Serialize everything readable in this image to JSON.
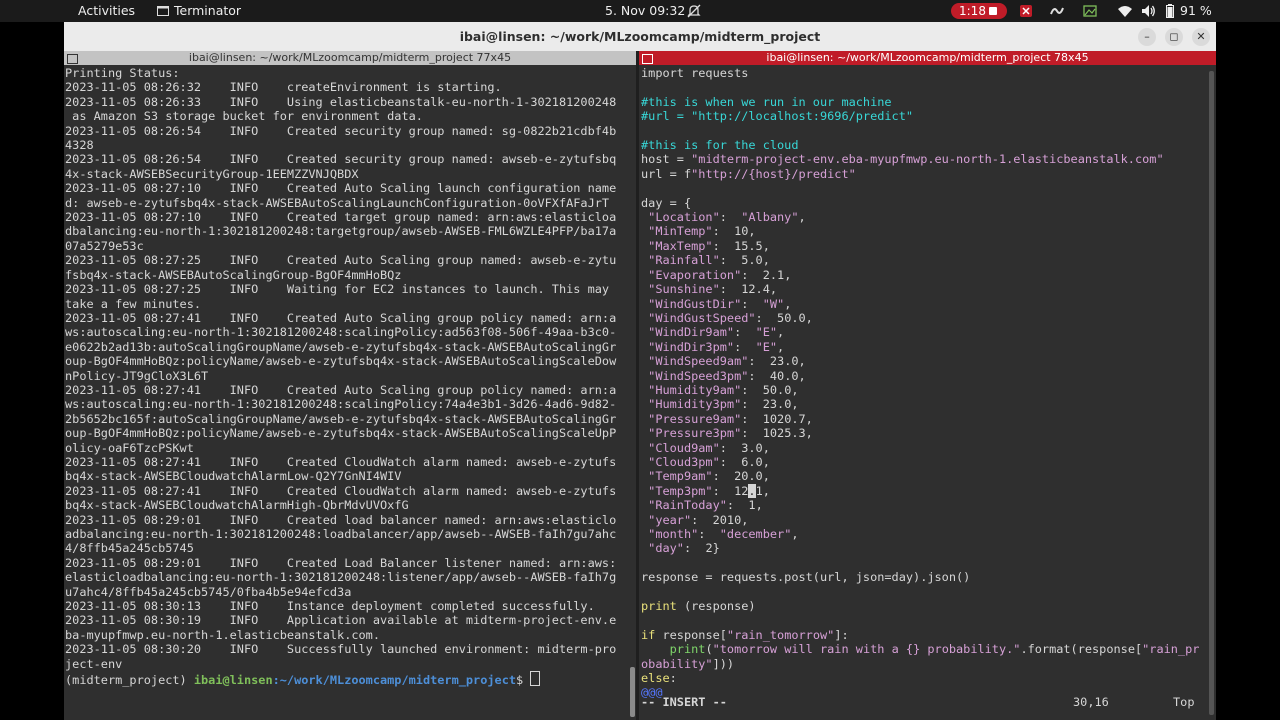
{
  "topbar": {
    "activities": "Activities",
    "app_name": "Terminator",
    "datetime": "5. Nov  09:32",
    "recording_time": "1:18",
    "battery": "91 %"
  },
  "window": {
    "title": "ibai@linsen: ~/work/MLzoomcamp/midterm_project",
    "minimize": "–",
    "maximize": "◻",
    "close": "✕"
  },
  "left_pane": {
    "title": "ibai@linsen: ~/work/MLzoomcamp/midterm_project 77x45",
    "lines": [
      "Printing Status:",
      "2023-11-05 08:26:32    INFO    createEnvironment is starting.",
      "2023-11-05 08:26:33    INFO    Using elasticbeanstalk-eu-north-1-302181200248",
      " as Amazon S3 storage bucket for environment data.",
      "2023-11-05 08:26:54    INFO    Created security group named: sg-0822b21cdbf4b",
      "4328",
      "2023-11-05 08:26:54    INFO    Created security group named: awseb-e-zytufsbq",
      "4x-stack-AWSEBSecurityGroup-1EEMZZVNJQBDX",
      "2023-11-05 08:27:10    INFO    Created Auto Scaling launch configuration name",
      "d: awseb-e-zytufsbq4x-stack-AWSEBAutoScalingLaunchConfiguration-0oVFXfAFaJrT",
      "2023-11-05 08:27:10    INFO    Created target group named: arn:aws:elasticloa",
      "dbalancing:eu-north-1:302181200248:targetgroup/awseb-AWSEB-FML6WZLE4PFP/ba17a",
      "07a5279e53c",
      "2023-11-05 08:27:25    INFO    Created Auto Scaling group named: awseb-e-zytu",
      "fsbq4x-stack-AWSEBAutoScalingGroup-BgOF4mmHoBQz",
      "2023-11-05 08:27:25    INFO    Waiting for EC2 instances to launch. This may",
      "take a few minutes.",
      "2023-11-05 08:27:41    INFO    Created Auto Scaling group policy named: arn:a",
      "ws:autoscaling:eu-north-1:302181200248:scalingPolicy:ad563f08-506f-49aa-b3c0-",
      "e0622b2ad13b:autoScalingGroupName/awseb-e-zytufsbq4x-stack-AWSEBAutoScalingGr",
      "oup-BgOF4mmHoBQz:policyName/awseb-e-zytufsbq4x-stack-AWSEBAutoScalingScaleDow",
      "nPolicy-JT9gCloX3L6T",
      "2023-11-05 08:27:41    INFO    Created Auto Scaling group policy named: arn:a",
      "ws:autoscaling:eu-north-1:302181200248:scalingPolicy:74a4e3b1-3d26-4ad6-9d82-",
      "2b5652bc165f:autoScalingGroupName/awseb-e-zytufsbq4x-stack-AWSEBAutoScalingGr",
      "oup-BgOF4mmHoBQz:policyName/awseb-e-zytufsbq4x-stack-AWSEBAutoScalingScaleUpP",
      "olicy-oaF6TzcPSKwt",
      "2023-11-05 08:27:41    INFO    Created CloudWatch alarm named: awseb-e-zytufs",
      "bq4x-stack-AWSEBCloudwatchAlarmLow-Q2Y7GnNI4WIV",
      "2023-11-05 08:27:41    INFO    Created CloudWatch alarm named: awseb-e-zytufs",
      "bq4x-stack-AWSEBCloudwatchAlarmHigh-QbrMdvUVOxfG",
      "2023-11-05 08:29:01    INFO    Created load balancer named: arn:aws:elasticlo",
      "adbalancing:eu-north-1:302181200248:loadbalancer/app/awseb--AWSEB-faIh7gu7ahc",
      "4/8ffb45a245cb5745",
      "2023-11-05 08:29:01    INFO    Created Load Balancer listener named: arn:aws:",
      "elasticloadbalancing:eu-north-1:302181200248:listener/app/awseb--AWSEB-faIh7g",
      "u7ahc4/8ffb45a245cb5745/0fba4b5e94efcd3a",
      "2023-11-05 08:30:13    INFO    Instance deployment completed successfully.",
      "2023-11-05 08:30:19    INFO    Application available at midterm-project-env.e",
      "ba-myupfmwp.eu-north-1.elasticbeanstalk.com.",
      "2023-11-05 08:30:20    INFO    Successfully launched environment: midterm-pro",
      "ject-env"
    ],
    "prompt_env": "(midterm_project) ",
    "prompt_user": "ibai@linsen",
    "prompt_path": ":~/work/MLzoomcamp/midterm_project",
    "prompt_symbol": "$ "
  },
  "right_pane": {
    "title": "ibai@linsen: ~/work/MLzoomcamp/midterm_project 78x45",
    "code": {
      "import": "import requests",
      "comment_local": "#this is when we run in our machine",
      "comment_url": "#url = \"http://localhost:9696/predict\"",
      "comment_cloud": "#this is for the cloud",
      "host_prefix": "host = ",
      "host_value": "\"midterm-project-env.eba-myupfmwp.eu-north-1.elasticbeanstalk.com\"",
      "url_prefix": "url = f",
      "url_value": "\"http://{host}/predict\"",
      "day_open": "day = {",
      "day_items": [
        {
          "key": "\"Location\"",
          "val": "\"Albany\"",
          "num": false
        },
        {
          "key": "\"MinTemp\"",
          "val": "10",
          "num": true
        },
        {
          "key": "\"MaxTemp\"",
          "val": "15.5",
          "num": true
        },
        {
          "key": "\"Rainfall\"",
          "val": "5.0",
          "num": true
        },
        {
          "key": "\"Evaporation\"",
          "val": "2.1",
          "num": true
        },
        {
          "key": "\"Sunshine\"",
          "val": "12.4",
          "num": true
        },
        {
          "key": "\"WindGustDir\"",
          "val": "\"W\"",
          "num": false
        },
        {
          "key": "\"WindGustSpeed\"",
          "val": "50.0",
          "num": true
        },
        {
          "key": "\"WindDir9am\"",
          "val": "\"E\"",
          "num": false
        },
        {
          "key": "\"WindDir3pm\"",
          "val": "\"E\"",
          "num": false
        },
        {
          "key": "\"WindSpeed9am\"",
          "val": "23.0",
          "num": true
        },
        {
          "key": "\"WindSpeed3pm\"",
          "val": "40.0",
          "num": true
        },
        {
          "key": "\"Humidity9am\"",
          "val": "50.0",
          "num": true
        },
        {
          "key": "\"Humidity3pm\"",
          "val": "23.0",
          "num": true
        },
        {
          "key": "\"Pressure9am\"",
          "val": "1020.7",
          "num": true
        },
        {
          "key": "\"Pressure3pm\"",
          "val": "1025.3",
          "num": true
        },
        {
          "key": "\"Cloud9am\"",
          "val": "3.0",
          "num": true
        },
        {
          "key": "\"Cloud3pm\"",
          "val": "6.0",
          "num": true
        },
        {
          "key": "\"Temp9am\"",
          "val": "20.0",
          "num": true
        },
        {
          "key": "\"Temp3pm\"",
          "val": "12.1",
          "num": true
        },
        {
          "key": "\"RainToday\"",
          "val": "1",
          "num": true
        },
        {
          "key": "\"year\"",
          "val": "2010",
          "num": true
        },
        {
          "key": "\"month\"",
          "val": "\"december\"",
          "num": false
        },
        {
          "key": "\"day\"",
          "val": "2}",
          "num": true
        }
      ],
      "response_line": "response = requests.post(url, json=day).json()",
      "print_kw": "print",
      "print_args": " (response)",
      "if_kw": "if",
      "if_rest_a": " response[",
      "if_str": "\"rain_tomorrow\"",
      "if_rest_b": "]:",
      "print2_indent": "    ",
      "print2_fn": "print",
      "print2_open": "(",
      "print2_str": "\"tomorrow will rain with a {} probability.\"",
      "print2_mid": ".format(response[",
      "print2_str2": "\"rain_pr",
      "print2_cont_str": "obability\"",
      "print2_cont_rest": "]))",
      "else_kw": "else",
      "else_rest": ":",
      "vim_trunc": "@@@"
    },
    "status_mode": "-- INSERT --",
    "status_pos": "30,16",
    "status_scroll": "Top"
  }
}
